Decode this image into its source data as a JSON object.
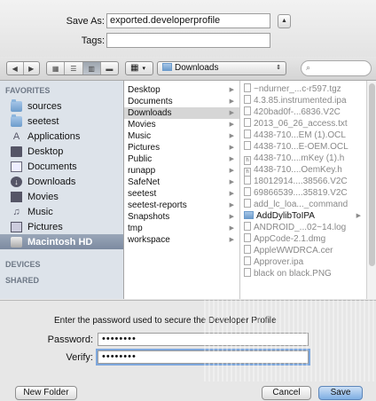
{
  "save_as": {
    "label": "Save As:",
    "value": "exported.developerprofile"
  },
  "tags": {
    "label": "Tags:",
    "value": ""
  },
  "toolbar": {
    "location": "Downloads"
  },
  "sidebar": {
    "favorites_header": "FAVORITES",
    "favorites": [
      "sources",
      "seetest",
      "Applications",
      "Desktop",
      "Documents",
      "Downloads",
      "Movies",
      "Music",
      "Pictures",
      "Macintosh HD"
    ],
    "devices_header": "DEVICES",
    "shared_header": "SHARED"
  },
  "column1": [
    "Desktop",
    "Documents",
    "Downloads",
    "Movies",
    "Music",
    "Pictures",
    "Public",
    "runapp",
    "SafeNet",
    "seetest",
    "seetest-reports",
    "Snapshots",
    "tmp",
    "workspace"
  ],
  "column2": [
    "~ndurner_...c-r597.tgz",
    "4.3.85.instrumented.ipa",
    "420bad0f-...6836.V2C",
    "2013_06_26_access.txt",
    "4438-710...EM (1).OCL",
    "4438-710...E-OEM.OCL",
    "4438-710....mKey (1).h",
    "4438-710....OemKey.h",
    "18012914....38566.V2C",
    "69866539....35819.V2C",
    "add_lc_loa..._command",
    "AddDylibToIPA",
    "ANDROID_...02~14.log",
    "AppCode-2.1.dmg",
    "AppleWWDRCA.cer",
    "Approver.ipa",
    "black on black.PNG"
  ],
  "sheet": {
    "message": "Enter the password used to secure the Developer Profile",
    "password_label": "Password:",
    "password_value": "••••••••",
    "verify_label": "Verify:",
    "verify_value": "••••••••"
  },
  "buttons": {
    "new_folder": "New Folder",
    "cancel": "Cancel",
    "save": "Save"
  }
}
